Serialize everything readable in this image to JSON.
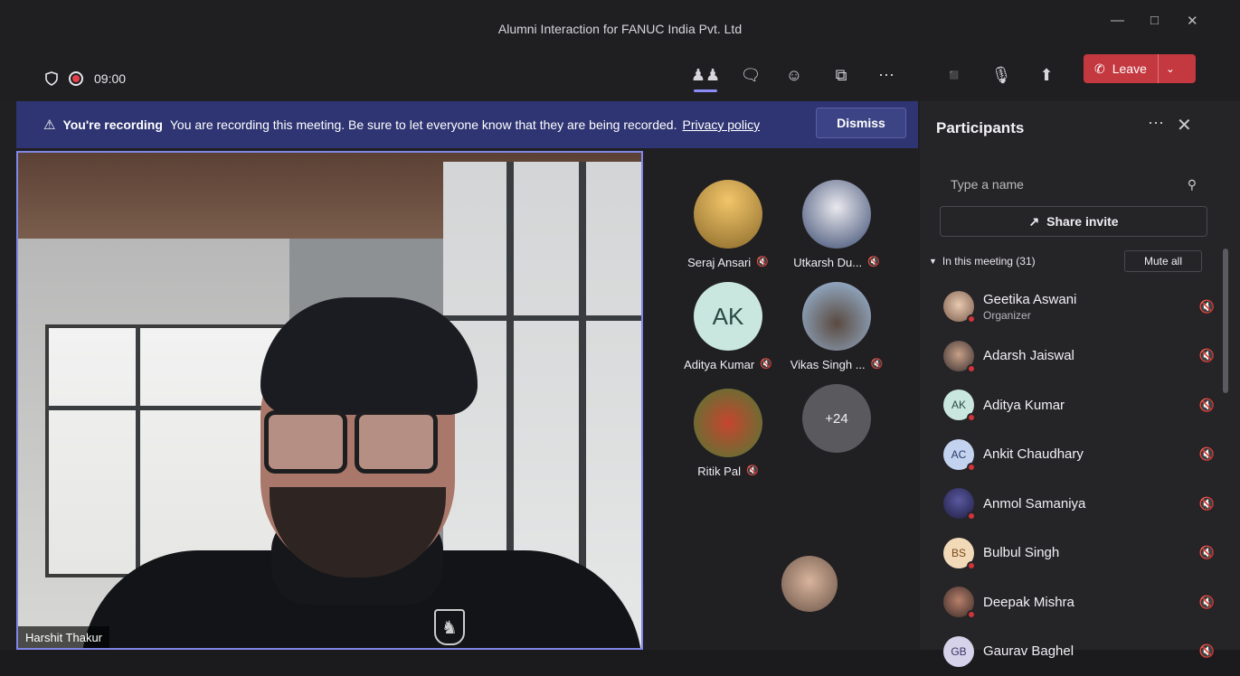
{
  "window": {
    "title": "Alumni Interaction for FANUC India Pvt. Ltd"
  },
  "toolbar": {
    "timer": "09:00",
    "leave_label": "Leave",
    "icons": [
      "shield-icon",
      "record-icon",
      "people-icon",
      "chat-icon",
      "reactions-icon",
      "rooms-icon",
      "more-icon",
      "camera-off-icon",
      "mic-off-icon",
      "share-icon",
      "phone-icon"
    ]
  },
  "banner": {
    "heading": "You're recording",
    "message": "You are recording this meeting. Be sure to let everyone know that they are being recorded.",
    "link": "Privacy policy",
    "dismiss_label": "Dismiss"
  },
  "stage": {
    "speaker_name": "Harshit Thakur"
  },
  "gallery": {
    "tiles": [
      {
        "name": "Seraj Ansari",
        "initials": "",
        "color": "#c99b47"
      },
      {
        "name": "Utkarsh Du...",
        "initials": "",
        "color": "#4a5a8a"
      },
      {
        "name": "Aditya Kumar",
        "initials": "AK",
        "color": "#c9e7de"
      },
      {
        "name": "Vikas Singh ...",
        "initials": "",
        "color": "#8ab0d8"
      },
      {
        "name": "Ritik Pal",
        "initials": "",
        "color": "#5c8a3e"
      },
      {
        "name": "",
        "initials": "+24",
        "color": "#5a595e"
      }
    ],
    "bottom_tile_color": "#c9a58c"
  },
  "participants": {
    "heading": "Participants",
    "search_placeholder": "Type a name",
    "share_label": "Share invite",
    "section_label": "In this meeting (31)",
    "mute_all_label": "Mute all",
    "list": [
      {
        "name": "Geetika Aswani",
        "role": "Organizer",
        "initials": "",
        "color": "#c9a58c"
      },
      {
        "name": "Adarsh Jaiswal",
        "role": "",
        "initials": "",
        "color": "#7a5c4a"
      },
      {
        "name": "Aditya Kumar",
        "role": "",
        "initials": "AK",
        "color": "#c9e7de"
      },
      {
        "name": "Ankit Chaudhary",
        "role": "",
        "initials": "AC",
        "color": "#c3d3ef"
      },
      {
        "name": "Anmol Samaniya",
        "role": "",
        "initials": "",
        "color": "#3b3a6a"
      },
      {
        "name": "Bulbul Singh",
        "role": "",
        "initials": "BS",
        "color": "#f2d9b8"
      },
      {
        "name": "Deepak Mishra",
        "role": "",
        "initials": "",
        "color": "#8a5a48"
      },
      {
        "name": "Gaurav Baghel",
        "role": "",
        "initials": "GB",
        "color": "#d6d2ea"
      }
    ]
  }
}
